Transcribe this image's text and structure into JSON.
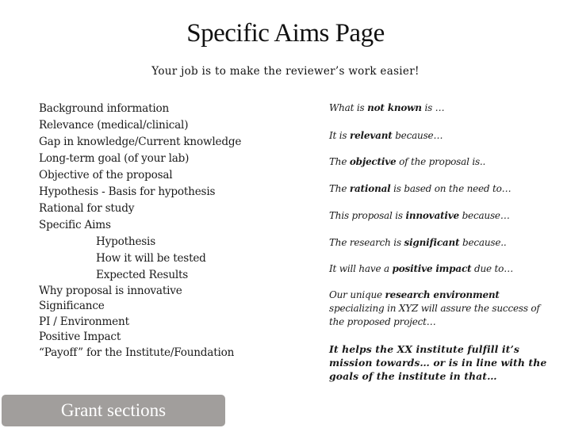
{
  "header": {
    "title": "Specific Aims Page",
    "subtitle": "Your job is to make the reviewer’s work easier!"
  },
  "grant_sections": [
    {
      "label": "Background information",
      "level": 0
    },
    {
      "label": "Relevance (medical/clinical)",
      "level": 0
    },
    {
      "label": "Gap in knowledge/Current knowledge",
      "level": 0
    },
    {
      "label": "Long-term goal (of your lab)",
      "level": 0
    },
    {
      "label": "Objective of the proposal",
      "level": 0
    },
    {
      "label": "Hypothesis - Basis for hypothesis",
      "level": 0
    },
    {
      "label": "Rational for study",
      "level": 0
    },
    {
      "label": "Specific Aims",
      "level": 0
    },
    {
      "label": "Hypothesis",
      "level": 1
    },
    {
      "label": "How it will be tested",
      "level": 1
    },
    {
      "label": "Expected Results",
      "level": 1
    },
    {
      "label": "Why proposal is innovative",
      "level": 0
    },
    {
      "label": "Significance",
      "level": 0
    },
    {
      "label": "PI / Environment",
      "level": 0
    },
    {
      "label": "Positive Impact",
      "level": 0
    },
    {
      "label": "“Payoff” for the Institute/Foundation",
      "level": 0
    }
  ],
  "phrases": [
    {
      "before": "What is ",
      "bold": "not known",
      "after": " is …"
    },
    {
      "before": "It is ",
      "bold": "relevant",
      "after": " because…"
    },
    {
      "before": "The ",
      "bold": "objective",
      "after": " of the proposal is.."
    },
    {
      "before": "The ",
      "bold": "rational",
      "after": " is based on the need to…"
    },
    {
      "before": "This proposal is ",
      "bold": "innovative",
      "after": " because…"
    },
    {
      "before": "The research is ",
      "bold": "significant",
      "after": " because.."
    },
    {
      "before": "It will have a ",
      "bold": "positive impact",
      "after": " due to…"
    },
    {
      "before": "Our unique ",
      "bold": "research environment",
      "after": " specializing in XYZ will assure the success of the proposed project…"
    },
    {
      "before": "",
      "bold": "It helps the XX institute fulfill it’s mission towards… or  is in line with the goals of the institute in that…",
      "after": ""
    }
  ],
  "footer": {
    "label": "Grant sections",
    "color": "#a19e9c"
  }
}
